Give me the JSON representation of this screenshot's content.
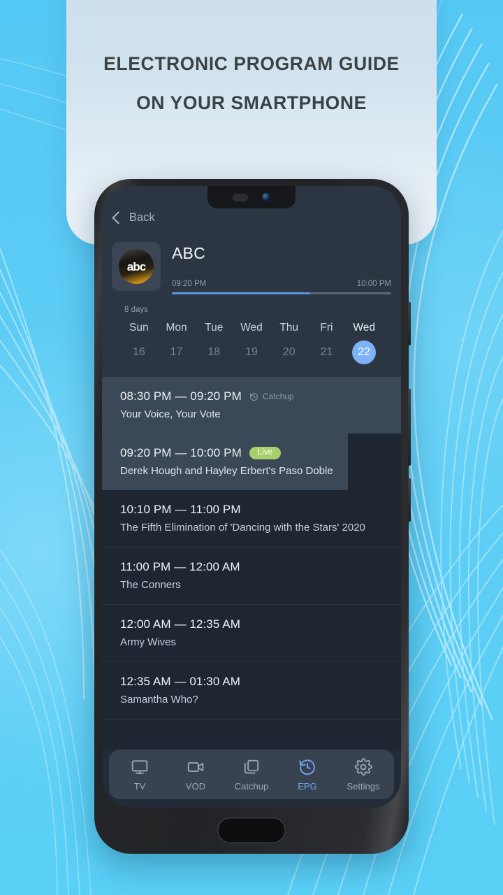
{
  "promo": {
    "headline_line1": "ELECTRONIC PROGRAM GUIDE",
    "headline_line2": "ON YOUR SMARTPHONE"
  },
  "colors": {
    "background": "#5ecdf5",
    "card": "#d2e3ef",
    "screen_bg": "#222c38",
    "list_bg": "#1e2632",
    "header_bg": "#2c3643",
    "accent_blue": "#7eb2f7",
    "progress_blue": "#5f94e0",
    "live_badge_green": "#a9cf6b",
    "active_nav": "#6fa8f5",
    "row_highlight": "#3b4857"
  },
  "app": {
    "back": {
      "label": "Back",
      "icon": "chevron-left-icon"
    },
    "channel": {
      "name": "ABC",
      "logo_text": "abc",
      "now_time": "09:20 PM",
      "end_time": "10:00 PM",
      "progress_percent": 63
    },
    "days": {
      "count_label": "8 days",
      "items": [
        {
          "name": "Sun",
          "num": "16",
          "selected": false
        },
        {
          "name": "Mon",
          "num": "17",
          "selected": false
        },
        {
          "name": "Tue",
          "num": "18",
          "selected": false
        },
        {
          "name": "Wed",
          "num": "19",
          "selected": false
        },
        {
          "name": "Thu",
          "num": "20",
          "selected": false
        },
        {
          "name": "Fri",
          "num": "21",
          "selected": false
        },
        {
          "name": "Wed",
          "num": "22",
          "selected": true
        }
      ]
    },
    "programs": [
      {
        "time": "08:30 PM — 09:20 PM",
        "title": "Your Voice, Your Vote",
        "badge": "Catchup",
        "badge_type": "catchup",
        "state": "past"
      },
      {
        "time": "09:20 PM — 10:00 PM",
        "title": "Derek Hough and Hayley Erbert's Paso Doble",
        "badge": "Live",
        "badge_type": "live",
        "state": "live"
      },
      {
        "time": "10:10 PM — 11:00 PM",
        "title": "The Fifth Elimination of 'Dancing with the Stars' 2020",
        "badge": "",
        "badge_type": "none",
        "state": "upcoming"
      },
      {
        "time": "11:00 PM — 12:00 AM",
        "title": "The Conners",
        "badge": "",
        "badge_type": "none",
        "state": "upcoming"
      },
      {
        "time": "12:00 AM — 12:35 AM",
        "title": "Army Wives",
        "badge": "",
        "badge_type": "none",
        "state": "upcoming"
      },
      {
        "time": "12:35 AM — 01:30 AM",
        "title": "Samantha Who?",
        "badge": "",
        "badge_type": "none",
        "state": "upcoming"
      }
    ],
    "nav": [
      {
        "label": "TV",
        "icon": "tv-monitor-icon",
        "active": false
      },
      {
        "label": "VOD",
        "icon": "video-camera-icon",
        "active": false
      },
      {
        "label": "Catchup",
        "icon": "layers-icon",
        "active": false
      },
      {
        "label": "EPG",
        "icon": "clock-rewind-icon",
        "active": true
      },
      {
        "label": "Settings",
        "icon": "gear-icon",
        "active": false
      }
    ]
  }
}
